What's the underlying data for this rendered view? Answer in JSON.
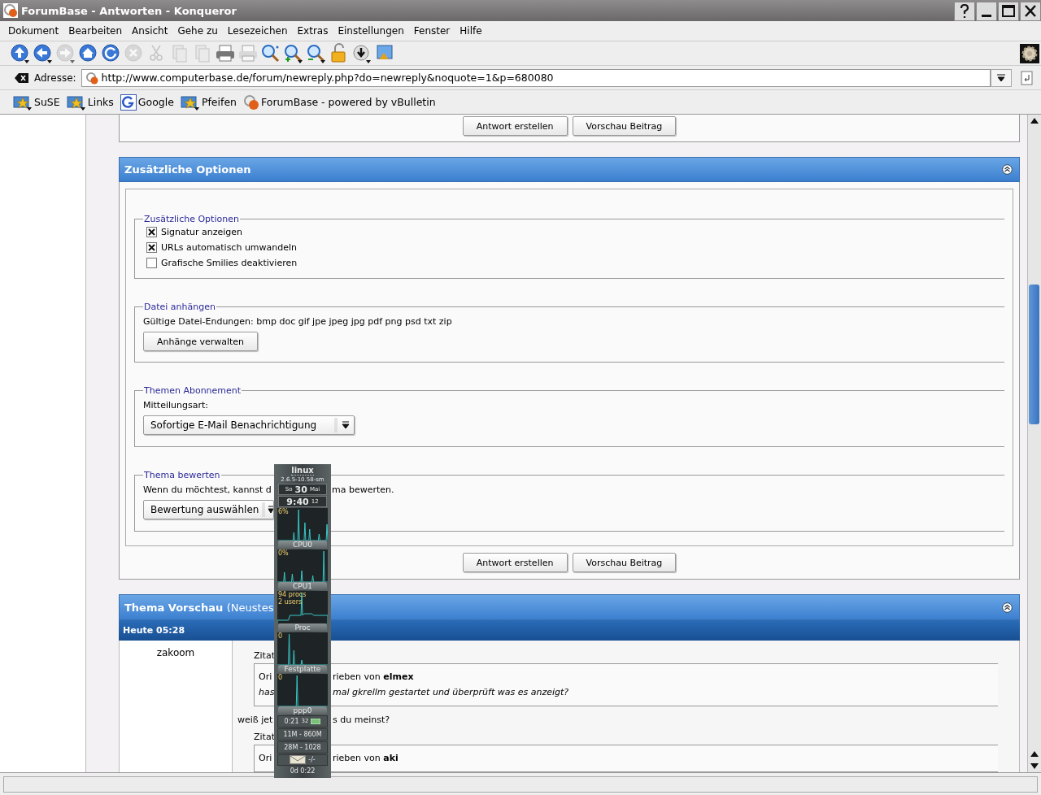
{
  "window": {
    "title": "ForumBase - Antworten - Konqueror"
  },
  "menu": [
    "Dokument",
    "Bearbeiten",
    "Ansicht",
    "Gehe zu",
    "Lesezeichen",
    "Extras",
    "Einstellungen",
    "Fenster",
    "Hilfe"
  ],
  "toolbar": [
    {
      "kind": "up",
      "disabled": false,
      "has_menu": true
    },
    {
      "kind": "back",
      "disabled": false,
      "has_menu": true
    },
    {
      "kind": "forward",
      "disabled": true,
      "has_menu": true
    },
    {
      "kind": "home",
      "disabled": false,
      "has_menu": false
    },
    {
      "kind": "reload",
      "disabled": false,
      "has_menu": false
    },
    {
      "kind": "stop",
      "disabled": true,
      "has_menu": false
    },
    {
      "kind": "cut",
      "disabled": true,
      "has_menu": false
    },
    {
      "kind": "copy",
      "disabled": true,
      "has_menu": false
    },
    {
      "kind": "paste",
      "disabled": true,
      "has_menu": false
    },
    {
      "kind": "print",
      "disabled": false,
      "has_menu": false
    },
    {
      "kind": "print",
      "disabled": true,
      "has_menu": false
    },
    {
      "kind": "find",
      "disabled": false,
      "has_menu": false
    },
    {
      "kind": "zoom-in",
      "disabled": false,
      "has_menu": true
    },
    {
      "kind": "zoom-out",
      "disabled": false,
      "has_menu": true
    },
    {
      "kind": "lock",
      "disabled": false,
      "has_menu": false
    },
    {
      "kind": "download",
      "disabled": false,
      "has_menu": true
    },
    {
      "kind": "window",
      "disabled": false,
      "has_menu": false
    }
  ],
  "address": {
    "label": "Adresse:",
    "value": "http://www.computerbase.de/forum/newreply.php?do=newreply&noquote=1&p=680080"
  },
  "bookmarks": [
    {
      "label": "SuSE",
      "kind": "folder"
    },
    {
      "label": "Links",
      "kind": "folder"
    },
    {
      "label": "Google",
      "kind": "google"
    },
    {
      "label": "Pfeifen",
      "kind": "folder"
    },
    {
      "label": "ForumBase - powered by vBulletin",
      "kind": "site"
    }
  ],
  "top_buttons": [
    "Antwort erstellen",
    "Vorschau Beitrag"
  ],
  "options_panel": {
    "title": "Zusätzliche Optionen",
    "groups": [
      {
        "kind": "checkboxes",
        "legend": "Zusätzliche Optionen",
        "options": [
          {
            "label": "Signatur anzeigen",
            "checked": true
          },
          {
            "label": "URLs automatisch umwandeln",
            "checked": true
          },
          {
            "label": "Grafische Smilies deaktivieren",
            "checked": false
          }
        ]
      },
      {
        "kind": "attach",
        "legend": "Datei anhängen",
        "text": "Gültige Datei-Endungen: bmp doc gif jpe jpeg jpg pdf png psd txt zip",
        "button": "Anhänge verwalten"
      },
      {
        "kind": "select",
        "legend": "Themen Abonnement",
        "label": "Mitteilungsart:",
        "value": "Sofortige E-Mail Benachrichtigung"
      },
      {
        "kind": "rating",
        "legend": "Thema bewerten",
        "text_parts": [
          "Wenn du möchtest, kannst d",
          "ma bewerten."
        ],
        "value": "Bewertung auswählen"
      }
    ],
    "buttons": [
      "Antwort erstellen",
      "Vorschau Beitrag"
    ]
  },
  "preview": {
    "title": "Thema Vorschau",
    "title_suffix": "(Neustes",
    "date": "Heute 05:28",
    "author": "zakoom",
    "blocks": [
      {
        "kind": "quote",
        "label": "Zitat",
        "lines": [
          {
            "parts": [
              "Ori",
              "rieben von **elmex**"
            ],
            "italic": false
          },
          {
            "parts": [
              "has",
              "mal gkrellm gestartet und überprüft was es anzeigt?"
            ],
            "italic": true
          }
        ]
      },
      {
        "kind": "text",
        "parts": [
          "weiß jet",
          "s du meinst?"
        ]
      },
      {
        "kind": "quote",
        "label": "Zitat",
        "lines": [
          {
            "parts": [
              "Ori",
              "rieben von **aki**"
            ],
            "italic": false
          }
        ]
      }
    ]
  },
  "monitor": {
    "host": "linux",
    "kernel": "2.6.5-10.58-sm",
    "day": "So",
    "date": "30",
    "month": "Mai",
    "time": "9:40",
    "seconds": "12",
    "panels": [
      {
        "label": "CPU0",
        "readings": [
          "6%"
        ]
      },
      {
        "label": "CPU1",
        "readings": [
          "0%"
        ]
      },
      {
        "label": "Proc",
        "readings": [
          "94 procs",
          "2 users"
        ]
      },
      {
        "label": "Festplatte",
        "readings": [
          "0"
        ]
      },
      {
        "label": "ppp0",
        "readings": [
          "0"
        ]
      }
    ],
    "timer": "0:21",
    "timer_extra": "32",
    "mem": "11M - 860M",
    "swap": "28M - 1028",
    "mail": "-/-",
    "uptime": "0d 0:22"
  }
}
